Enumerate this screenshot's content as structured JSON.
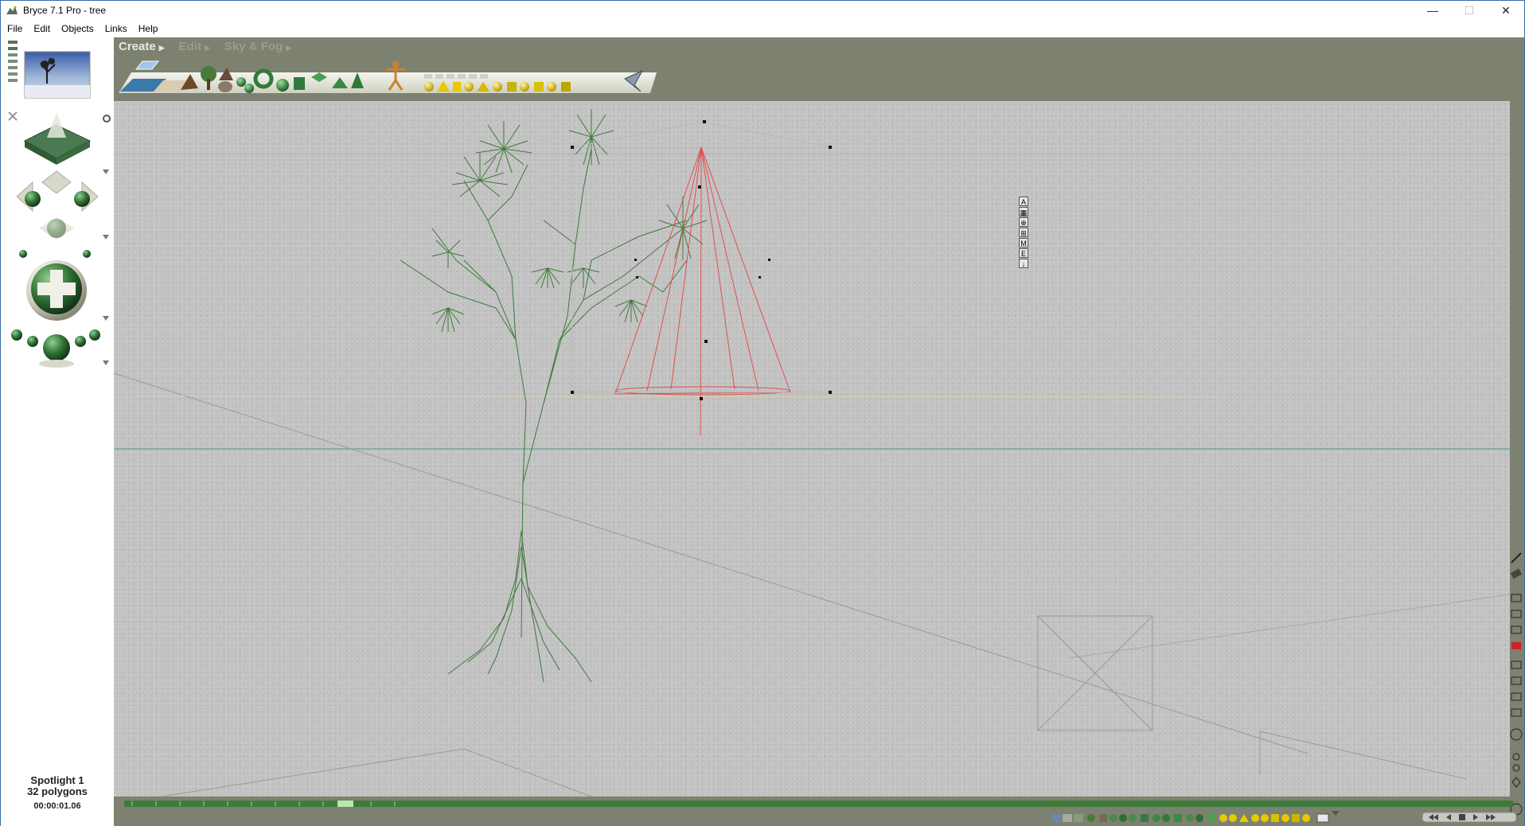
{
  "window": {
    "title": "Bryce 7.1  Pro - tree",
    "controls": {
      "minimize": "—",
      "maximize": "☐",
      "close": "✕"
    }
  },
  "menu": {
    "items": [
      "File",
      "Edit",
      "Objects",
      "Links",
      "Help"
    ]
  },
  "palette_tabs": [
    {
      "label": "Create",
      "active": true
    },
    {
      "label": "Edit",
      "active": false
    },
    {
      "label": "Sky & Fog",
      "active": false
    }
  ],
  "selection_tags": [
    "A",
    "▦",
    "⊕",
    "⊞",
    "M",
    "E",
    "↓"
  ],
  "status": {
    "object_name": "Spotlight 1",
    "polygons": "32 polygons",
    "time": "00:00:01.06"
  },
  "colors": {
    "background": "#7d8170",
    "viewport": "#c2c2c2",
    "selection": "#e05050",
    "tree": "#3e7a3a",
    "horizon": "#4a9a90"
  }
}
